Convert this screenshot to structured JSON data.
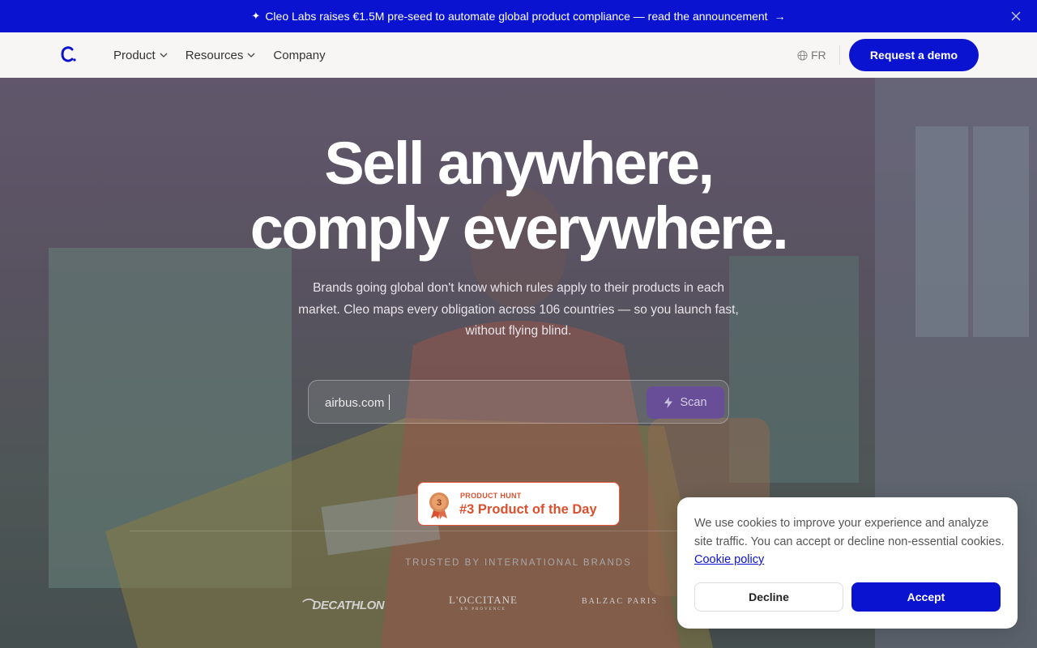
{
  "announcement": {
    "icon": "sparkle-icon",
    "text": "Cleo Labs raises €1.5M pre-seed to automate global product compliance — read the announcement",
    "arrow_icon": "arrow-right-icon",
    "close_icon": "close-icon"
  },
  "nav": {
    "logo_icon": "cleo-logo-icon",
    "items": [
      {
        "label": "Product",
        "has_dropdown": true
      },
      {
        "label": "Resources",
        "has_dropdown": true
      },
      {
        "label": "Company",
        "has_dropdown": false
      }
    ],
    "language": "FR",
    "language_icon": "globe-icon",
    "cta_label": "Request a demo"
  },
  "hero": {
    "headline_line1": "Sell anywhere,",
    "headline_line2": "comply everywhere.",
    "subheadline": "Brands going global don't know which rules apply to their products in each market. Cleo maps every obligation across 106 countries — so you launch fast, without flying blind.",
    "scan": {
      "value": "airbus.com",
      "button_label": "Scan",
      "button_icon": "lightning-icon"
    },
    "product_hunt": {
      "label": "PRODUCT HUNT",
      "title": "#3 Product of the Day",
      "rank": "3",
      "icon": "medal-icon"
    },
    "trusted_label": "TRUSTED BY INTERNATIONAL BRANDS",
    "brands": [
      "DECATHLON",
      "L'OCCITANE",
      "BALZAC PARIS"
    ],
    "brand_sublabel": "EN PROVENCE"
  },
  "cookie": {
    "text": "We use cookies to improve your experience and analyze site traffic. You can accept or decline non-essential cookies.",
    "link_label": "Cookie policy",
    "decline_label": "Decline",
    "accept_label": "Accept"
  },
  "colors": {
    "brand_blue": "#0a13cf",
    "product_hunt_orange": "#d9502f"
  }
}
